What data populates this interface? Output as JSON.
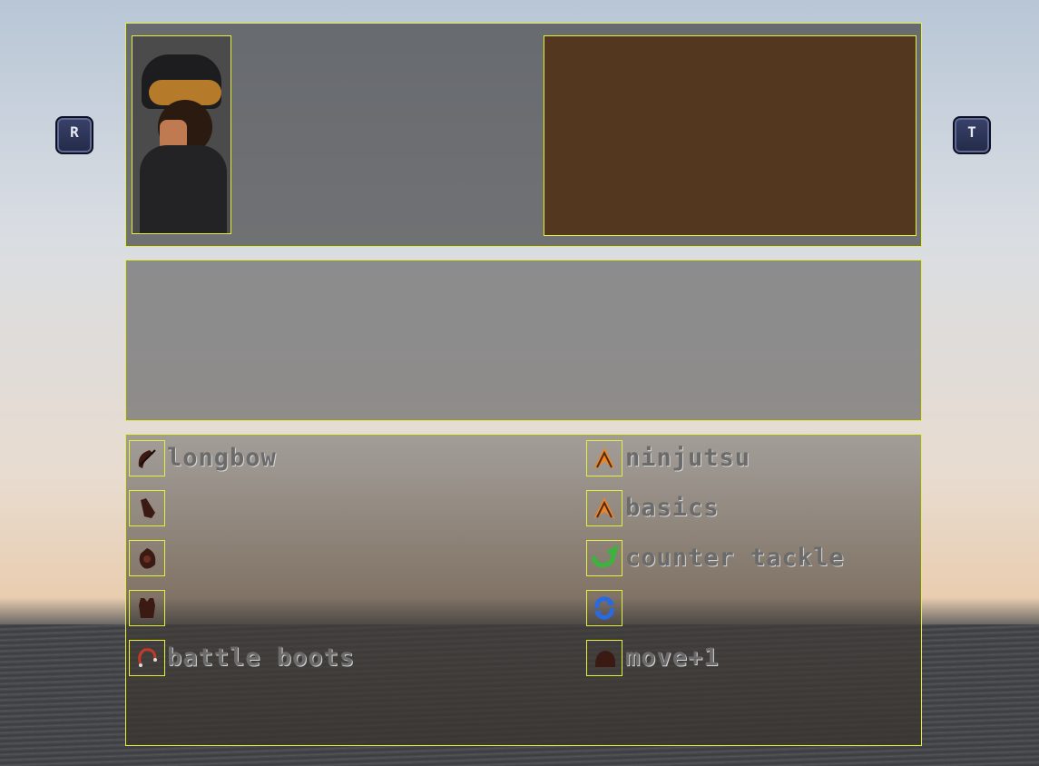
{
  "buttons": {
    "left_key": "R",
    "right_key": "T"
  },
  "character": {
    "name_line_1": "",
    "name_line_2": "",
    "name_line_3": ""
  },
  "info": {
    "line_1": "",
    "line_2": "",
    "line_3": "",
    "line_4": ""
  },
  "stats": {
    "col1": [
      {
        "label": "",
        "value": ""
      },
      {
        "label": "",
        "value": ""
      },
      {
        "label": "",
        "value": ""
      },
      {
        "label": "",
        "value": ""
      }
    ],
    "col2": [
      {
        "label": "",
        "value": ""
      },
      {
        "label": "",
        "value": ""
      },
      {
        "label": "",
        "value": ""
      },
      {
        "label": "",
        "value": ""
      }
    ],
    "col3": [
      {
        "label": "",
        "value": ""
      },
      {
        "label": "",
        "value": ""
      }
    ]
  },
  "equipment": {
    "left": [
      {
        "icon": "bow-icon",
        "label": "longbow"
      },
      {
        "icon": "gloves-icon",
        "label": ""
      },
      {
        "icon": "helmet-icon",
        "label": ""
      },
      {
        "icon": "armor-icon",
        "label": ""
      },
      {
        "icon": "boots-icon",
        "label": "battle boots"
      }
    ],
    "right": [
      {
        "icon": "ninjutsu-icon",
        "label": "ninjutsu"
      },
      {
        "icon": "basics-icon",
        "label": "basics"
      },
      {
        "icon": "counter-tackle-icon",
        "label": "counter tackle"
      },
      {
        "icon": "refresh-icon",
        "label": ""
      },
      {
        "icon": "move-icon",
        "label": "move+1"
      }
    ]
  },
  "colors": {
    "accent_outline": "#e5f03a",
    "info_bg": "#53371e",
    "text_gold": "#e8d25a"
  }
}
